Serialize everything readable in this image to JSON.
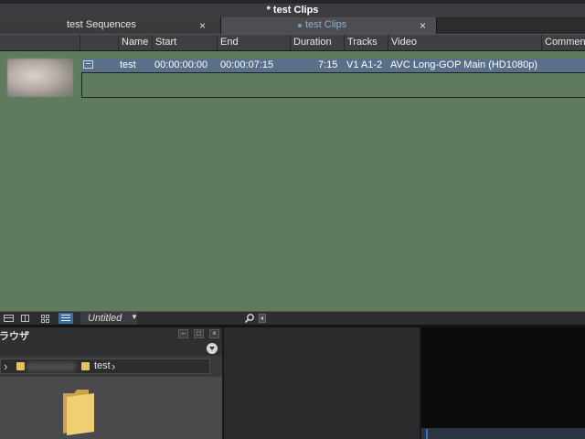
{
  "window": {
    "title": "* test Clips"
  },
  "tabs": [
    {
      "label": "test Sequences",
      "close": "×"
    },
    {
      "label": "test Clips",
      "close": "×"
    }
  ],
  "columns": [
    "Name",
    "Start",
    "End",
    "Duration",
    "Tracks",
    "Video",
    "Comment"
  ],
  "clips": [
    {
      "name": "test",
      "start": "00:00:00:00",
      "end": "00:00:07:15",
      "duration": "7:15",
      "tracks": "V1 A1-2",
      "video": "AVC Long-GOP Main (HD1080p)",
      "comment": ""
    }
  ],
  "bin_toolbar": {
    "view_name": "Untitled",
    "icons": [
      "frame-view-icon",
      "script-view-icon",
      "grid-view-icon",
      "list-view-icon",
      "search-icon"
    ]
  },
  "browser": {
    "title": "ラウザ",
    "path": {
      "current": "test"
    },
    "window_buttons": [
      "–",
      "□",
      "×"
    ]
  },
  "colors": {
    "bin_background": "#5f7a5c",
    "selected_row": "#5a6f8a",
    "active_view_button": "#3d6fa0",
    "folder": "#e8c15a"
  }
}
